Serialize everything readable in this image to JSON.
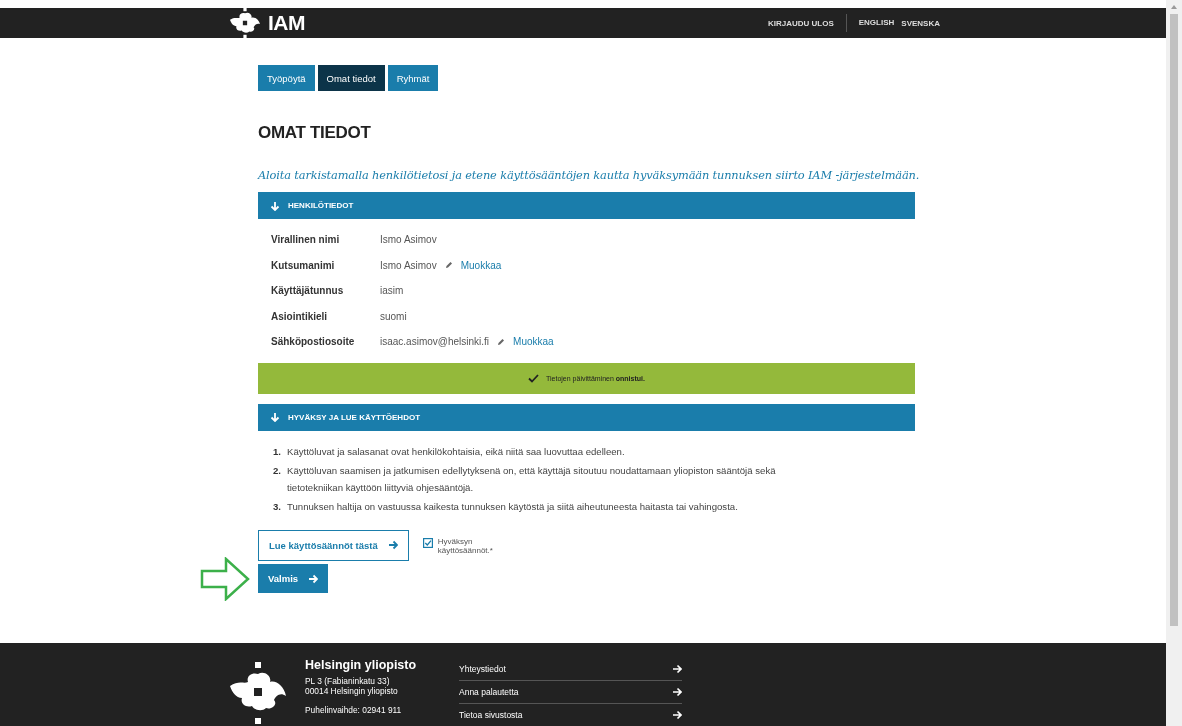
{
  "header": {
    "logo_text": "IAM",
    "links": [
      {
        "label": "KIRJAUDU ULOS"
      },
      {
        "label": "ENGLISH"
      },
      {
        "label": "SVENSKA"
      }
    ]
  },
  "tabs": [
    {
      "label": "Työpöytä",
      "selected": false
    },
    {
      "label": "Omat tiedot",
      "selected": true
    },
    {
      "label": "Ryhmät",
      "selected": false
    }
  ],
  "page_title": "OMAT TIEDOT",
  "lead": "Aloita tarkistamalla henkilötietosi ja etene käyttösääntöjen kautta hyväksymään tunnuksen siirto IAM -järjestelmään.",
  "personal_section": {
    "title": "HENKILÖTIEDOT",
    "expanded": true,
    "fields": [
      {
        "label": "Virallinen nimi",
        "value": "Ismo Asimov"
      },
      {
        "label": "Kutsumanimi",
        "value": "Ismo Asimov",
        "edit_link": "Muokkaa"
      },
      {
        "label": "Käyttäjätunnus",
        "value": "iasim"
      },
      {
        "label": "Asiointikieli",
        "value": "suomi"
      },
      {
        "label": "Sähköpostiosoite",
        "value": "isaac.asimov@helsinki.fi",
        "edit_link": "Muokkaa"
      }
    ],
    "notice": "Tietojen päivittäminen **onnistui.**"
  },
  "terms_section": {
    "title": "HYVÄKSY JA LUE KÄYTTÖEHDOT",
    "expanded": true,
    "items": [
      {
        "number": "1.",
        "text": "Käyttöluvat ja salasanat ovat henkilökohtaisia, eikä niitä saa luovuttaa edelleen."
      },
      {
        "number": "2.",
        "text": "Käyttöluvan saamisen ja jatkumisen edellytyksenä on, että käyttäjä sitoutuu noudattamaan yliopiston sääntöjä sekä tietotekniikan käyttöön liittyviä ohjesääntöjä."
      },
      {
        "number": "3.",
        "text": "Tunnuksen haltija on vastuussa kaikesta tunnuksen käytöstä ja siitä aiheutuneesta haitasta tai vahingosta."
      }
    ],
    "read_button": "Lue käyttösäännöt tästä",
    "accept_checkbox": {
      "label": "Hyväksyn käyttösäännöt.*",
      "checked": true
    }
  },
  "done_button": "Valmis",
  "footer": {
    "name": "Helsingin yliopisto",
    "address": [
      "PL 3 (Fabianinkatu 33)",
      "00014 Helsingin yliopisto"
    ],
    "phone": "Puhelinvaihde: 02941 911",
    "links": [
      {
        "label": "Yhteystiedot"
      },
      {
        "label": "Anna palautetta"
      },
      {
        "label": "Tietoa sivustosta"
      }
    ]
  }
}
